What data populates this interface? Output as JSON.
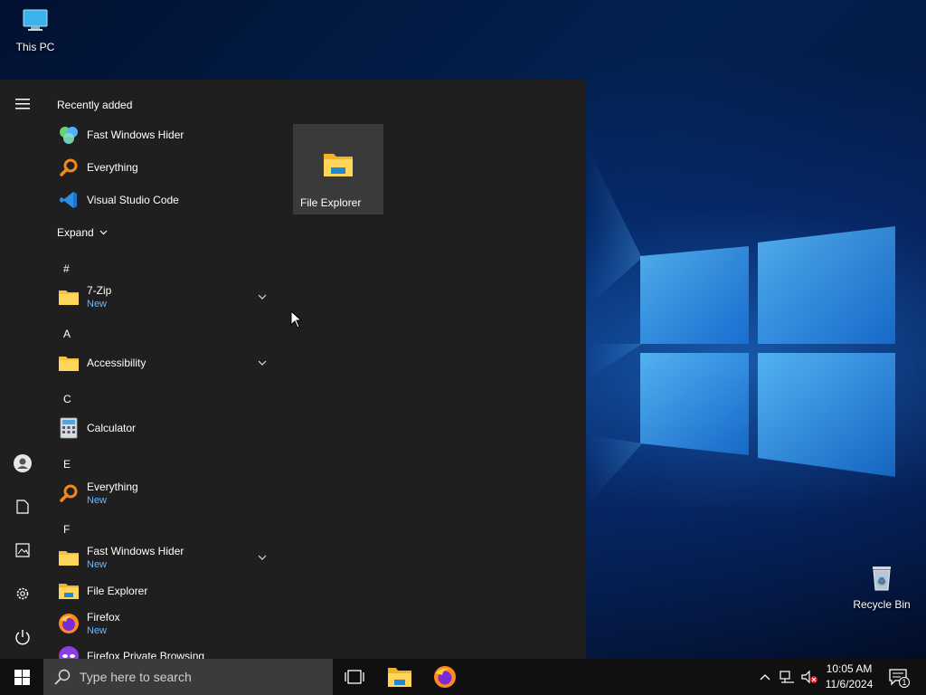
{
  "desktop": {
    "icons": [
      {
        "label": "This PC",
        "icon": "computer-icon"
      },
      {
        "label": "Recycle Bin",
        "icon": "recycle-bin-icon"
      }
    ]
  },
  "start_menu": {
    "recently_added_header": "Recently added",
    "recently_added": [
      {
        "name": "Fast Windows Hider",
        "icon": "fast-windows-hider-icon"
      },
      {
        "name": "Everything",
        "icon": "everything-search-icon"
      },
      {
        "name": "Visual Studio Code",
        "icon": "vscode-icon"
      }
    ],
    "expand_label": "Expand",
    "groups": [
      {
        "letter": "#",
        "apps": [
          {
            "name": "7-Zip",
            "badge": "New",
            "icon": "folder-icon",
            "expandable": true
          }
        ]
      },
      {
        "letter": "A",
        "apps": [
          {
            "name": "Accessibility",
            "icon": "folder-icon",
            "expandable": true
          }
        ]
      },
      {
        "letter": "C",
        "apps": [
          {
            "name": "Calculator",
            "icon": "calculator-icon"
          }
        ]
      },
      {
        "letter": "E",
        "apps": [
          {
            "name": "Everything",
            "badge": "New",
            "icon": "everything-search-icon"
          }
        ]
      },
      {
        "letter": "F",
        "apps": [
          {
            "name": "Fast Windows Hider",
            "badge": "New",
            "icon": "folder-icon",
            "expandable": true
          },
          {
            "name": "File Explorer",
            "icon": "file-explorer-icon"
          },
          {
            "name": "Firefox",
            "badge": "New",
            "icon": "firefox-icon"
          },
          {
            "name": "Firefox Private Browsing",
            "icon": "firefox-private-icon"
          }
        ]
      }
    ],
    "tiles": [
      {
        "label": "File Explorer",
        "icon": "file-explorer-icon"
      }
    ],
    "rail": [
      "hamburger-icon",
      "user-icon",
      "documents-icon",
      "pictures-icon",
      "settings-icon",
      "power-icon"
    ]
  },
  "taskbar": {
    "search_placeholder": "Type here to search",
    "time": "10:05 AM",
    "date": "11/6/2024",
    "notification_count": "1",
    "pinned": [
      "task-view-icon",
      "file-explorer-icon",
      "firefox-icon"
    ]
  },
  "colors": {
    "start_bg": "#1f1f1f",
    "tile_bg": "#3a3a3a",
    "new_badge": "#6cb6ff",
    "taskbar_bg": "#101010",
    "search_bg": "#3b3b3b"
  }
}
